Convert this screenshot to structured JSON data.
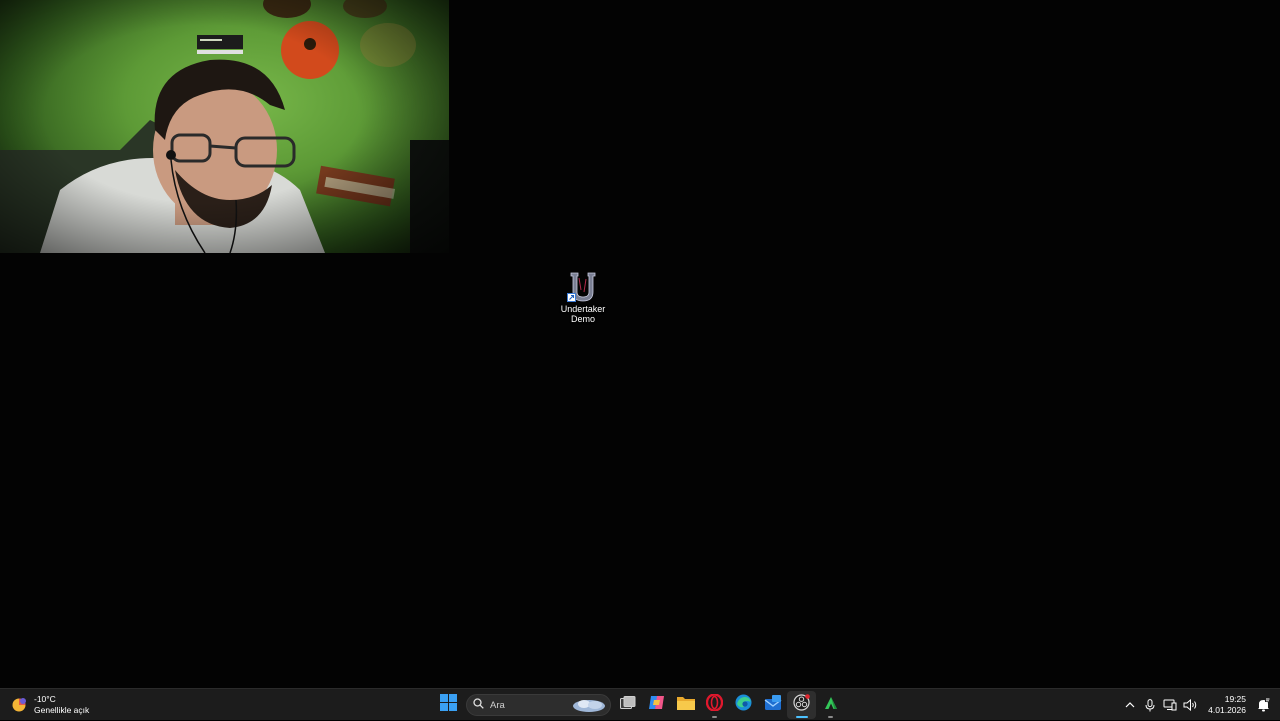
{
  "desktop": {
    "shortcut": {
      "label_line1": "Undertaker",
      "label_line2": "Demo",
      "icon": "undertaker-app-icon"
    },
    "webcam": {
      "description_icon": "webcam-feed"
    }
  },
  "taskbar": {
    "weather": {
      "temperature": "-10°C",
      "condition": "Genellikle açık",
      "icon": "weather-icon"
    },
    "search": {
      "placeholder": "Ara",
      "icon": "search-icon"
    },
    "apps": [
      {
        "name": "start-button",
        "icon": "windows-logo-icon"
      },
      {
        "name": "task-view",
        "icon": "task-view-icon"
      },
      {
        "name": "copilot",
        "icon": "copilot-icon"
      },
      {
        "name": "file-explorer",
        "icon": "folder-icon"
      },
      {
        "name": "opera",
        "icon": "opera-icon"
      },
      {
        "name": "edge",
        "icon": "edge-icon"
      },
      {
        "name": "mail",
        "icon": "mail-icon"
      },
      {
        "name": "obs",
        "icon": "obs-icon"
      },
      {
        "name": "nvidia-app",
        "icon": "green-app-icon"
      }
    ],
    "tray": {
      "chevron": "chevron-up-icon",
      "mic": "microphone-icon",
      "network": "network-icon",
      "volume": "volume-icon",
      "time": "19:25",
      "date": "4.01.2026",
      "notifications": "notification-bell-icon"
    },
    "colors": {
      "taskbar_bg": "#1c1c1c",
      "accent": "#4cc2ff",
      "windows_blue": "#3aa0f3"
    }
  }
}
